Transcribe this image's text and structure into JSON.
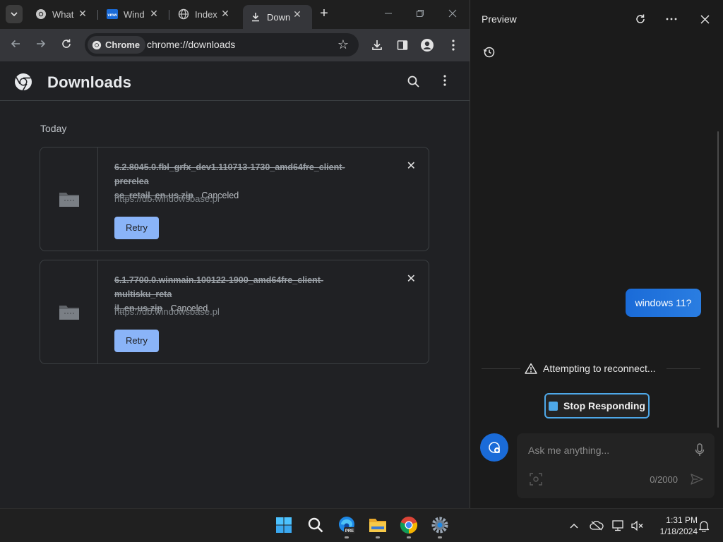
{
  "browser": {
    "tabs": [
      {
        "title": "What",
        "icon": "chrome-icon",
        "active": false
      },
      {
        "title": "Wind",
        "icon": "vmware-icon",
        "active": false
      },
      {
        "title": "Index",
        "icon": "globe-icon",
        "active": false
      },
      {
        "title": "Down",
        "icon": "download-icon",
        "active": true
      }
    ],
    "omnibox": {
      "chip_label": "Chrome",
      "url": "chrome://downloads"
    }
  },
  "downloads": {
    "title": "Downloads",
    "section_label": "Today",
    "items": [
      {
        "filename": "6.2.8045.0.fbl_grfx_dev1.110713-1730_amd64fre_client-prerelease_retail_en-us.zip",
        "filename_line1": "6.2.8045.0.fbl_grfx_dev1.110713-1730_amd64fre_client-prerelea",
        "filename_line2": "se_retail_en-us.zip",
        "status": "Canceled",
        "source": "https://db.windowsbase.pl",
        "retry_label": "Retry"
      },
      {
        "filename": "6.1.7700.0.winmain.100122-1900_amd64fre_client-multisku_retail_en-us.zip",
        "filename_line1": "6.1.7700.0.winmain.100122-1900_amd64fre_client-multisku_reta",
        "filename_line2": "il_en-us.zip",
        "status": "Canceled",
        "source": "https://db.windowsbase.pl",
        "retry_label": "Retry"
      }
    ]
  },
  "preview": {
    "title": "Preview",
    "user_message": "windows 11?",
    "reconnect_text": "Attempting to reconnect...",
    "stop_label": "Stop Responding",
    "input_placeholder": "Ask me anything...",
    "char_count": "0/2000"
  },
  "taskbar": {
    "apps": [
      "windows-start-icon",
      "search-icon",
      "edge-preview-icon",
      "file-explorer-icon",
      "chrome-icon",
      "settings-icon"
    ],
    "edge_badge": "PRE",
    "time": "1:31 PM",
    "date": "1/18/2024"
  },
  "colors": {
    "accent_blue": "#8ab4f8",
    "copilot_blue": "#1a6bd8",
    "stop_outline": "#4ea8e8"
  }
}
